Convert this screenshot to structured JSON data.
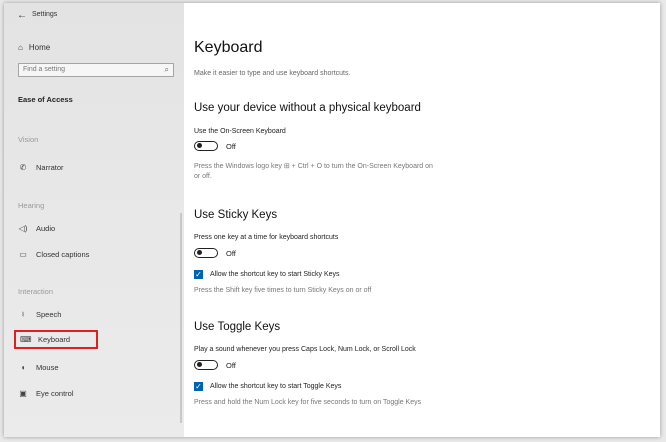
{
  "titlebar": {
    "back_icon": "back-arrow-icon",
    "title": "Settings"
  },
  "sidebar": {
    "home": {
      "icon": "home-icon",
      "label": "Home"
    },
    "search": {
      "placeholder": "Find a setting",
      "icon": "search-icon"
    },
    "section": "Ease of Access",
    "categories": {
      "vision": "Vision",
      "hearing": "Hearing",
      "interaction": "Interaction"
    },
    "items": {
      "narrator": {
        "icon": "narrator-icon",
        "label": "Narrator"
      },
      "audio": {
        "icon": "speaker-icon",
        "label": "Audio"
      },
      "closed_captions": {
        "icon": "cc-icon",
        "label": "Closed captions"
      },
      "speech": {
        "icon": "microphone-icon",
        "label": "Speech"
      },
      "keyboard": {
        "icon": "keyboard-icon",
        "label": "Keyboard",
        "selected": true
      },
      "mouse": {
        "icon": "mouse-icon",
        "label": "Mouse"
      },
      "eye_control": {
        "icon": "eye-control-icon",
        "label": "Eye control"
      }
    }
  },
  "main": {
    "title": "Keyboard",
    "subtitle": "Make it easier to type and use keyboard shortcuts.",
    "onscreen": {
      "heading": "Use your device without a physical keyboard",
      "label": "Use the On-Screen Keyboard",
      "state": "Off",
      "description": "Press the Windows logo key ⊞ + Ctrl + O to turn the On-Screen Keyboard on or off."
    },
    "sticky": {
      "heading": "Use Sticky Keys",
      "label": "Press one key at a time for keyboard shortcuts",
      "state": "Off",
      "checkbox_label": "Allow the shortcut key to start Sticky Keys",
      "checked": true,
      "description": "Press the Shift key five times to turn Sticky Keys on or off"
    },
    "toggle_keys": {
      "heading": "Use Toggle Keys",
      "label": "Play a sound whenever you press Caps Lock, Num Lock, or Scroll Lock",
      "state": "Off",
      "checkbox_label": "Allow the shortcut key to start Toggle Keys",
      "checked": true,
      "description": "Press and hold the Num Lock key for five seconds to turn on Toggle Keys"
    }
  },
  "colors": {
    "accent": "#0063b1",
    "highlight_border": "#e02020",
    "sidebar_bg": "#e6e6e6"
  }
}
